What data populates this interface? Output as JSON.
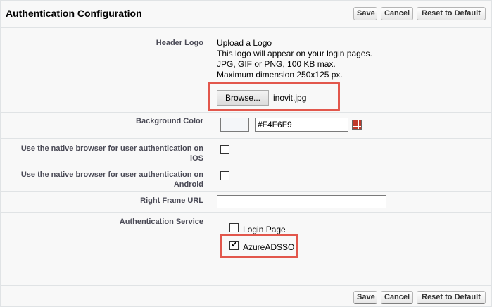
{
  "header": {
    "title": "Authentication Configuration",
    "save_label": "Save",
    "cancel_label": "Cancel",
    "reset_label": "Reset to Default"
  },
  "header_logo": {
    "label": "Header Logo",
    "info": [
      "Upload a Logo",
      "This logo will appear on your login pages.",
      "JPG, GIF or PNG, 100 KB max.",
      "Maximum dimension 250x125 px."
    ],
    "browse_label": "Browse...",
    "file_name": "inovit.jpg"
  },
  "background_color": {
    "label": "Background Color",
    "value": "#F4F6F9",
    "swatch_color": "#F4F6F9"
  },
  "native_ios": {
    "label_line1": "Use the native browser for user authentication on",
    "label_line2": "iOS",
    "checked": false
  },
  "native_android": {
    "label_line1": "Use the native browser for user authentication on",
    "label_line2": "Android",
    "checked": false
  },
  "right_frame_url": {
    "label": "Right Frame URL",
    "value": ""
  },
  "authentication_service": {
    "label": "Authentication Service",
    "options": [
      {
        "label": "Login Page",
        "checked": false
      },
      {
        "label": "AzureADSSO",
        "checked": true
      }
    ]
  },
  "footer": {
    "save_label": "Save",
    "cancel_label": "Cancel",
    "reset_label": "Reset to Default"
  },
  "colors": {
    "highlight": "#E2574C",
    "panel_bg": "#F8F8F8",
    "label_text": "#4A4A56"
  }
}
